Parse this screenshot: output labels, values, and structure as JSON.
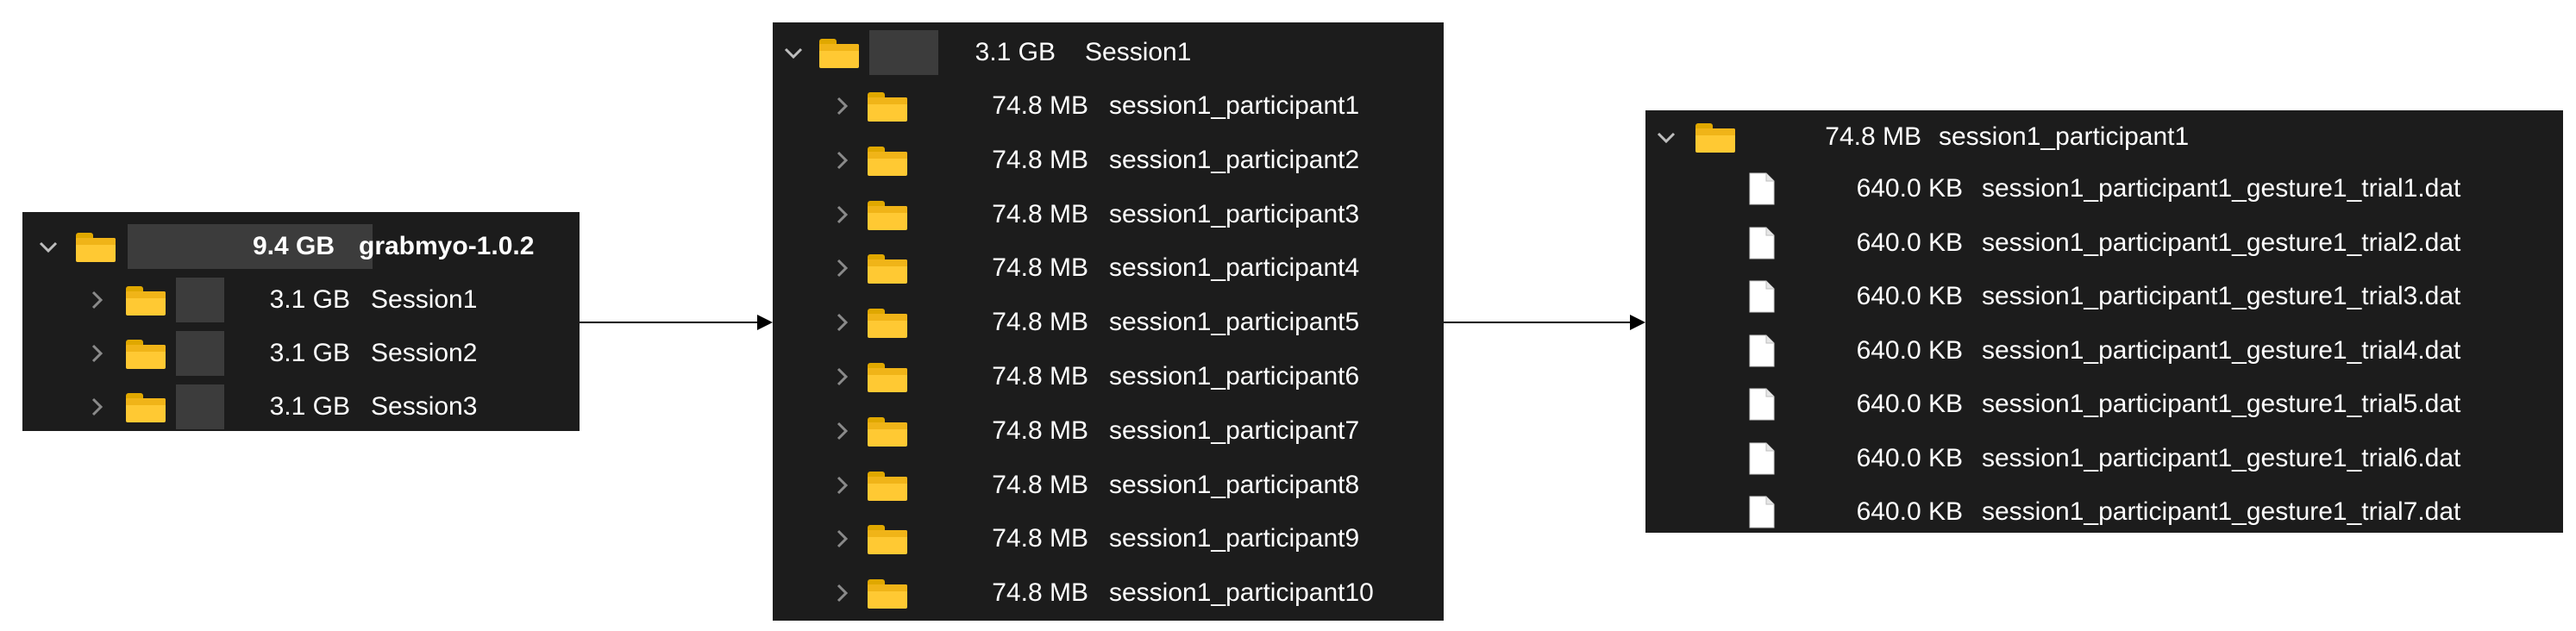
{
  "colors": {
    "panel_bg": "#1c1c1c",
    "text": "#ffffff",
    "folder": "#ffc933",
    "chevron": "#9a9a9a",
    "arrow": "#000000"
  },
  "icons": {
    "expanded": "chevron-down-icon",
    "collapsed": "chevron-right-icon",
    "folder": "folder-icon",
    "file": "file-icon"
  },
  "root": {
    "size": "9.4 GB",
    "name": "grabmyo-1.0.2",
    "children": [
      {
        "size": "3.1 GB",
        "name": "Session1"
      },
      {
        "size": "3.1 GB",
        "name": "Session2"
      },
      {
        "size": "3.1 GB",
        "name": "Session3"
      }
    ]
  },
  "session": {
    "size": "3.1 GB",
    "name": "Session1",
    "children": [
      {
        "size": "74.8 MB",
        "name": "session1_participant1"
      },
      {
        "size": "74.8 MB",
        "name": "session1_participant2"
      },
      {
        "size": "74.8 MB",
        "name": "session1_participant3"
      },
      {
        "size": "74.8 MB",
        "name": "session1_participant4"
      },
      {
        "size": "74.8 MB",
        "name": "session1_participant5"
      },
      {
        "size": "74.8 MB",
        "name": "session1_participant6"
      },
      {
        "size": "74.8 MB",
        "name": "session1_participant7"
      },
      {
        "size": "74.8 MB",
        "name": "session1_participant8"
      },
      {
        "size": "74.8 MB",
        "name": "session1_participant9"
      },
      {
        "size": "74.8 MB",
        "name": "session1_participant10"
      }
    ]
  },
  "participant": {
    "size": "74.8 MB",
    "name": "session1_participant1",
    "files": [
      {
        "size": "640.0 KB",
        "name": "session1_participant1_gesture1_trial1.dat"
      },
      {
        "size": "640.0 KB",
        "name": "session1_participant1_gesture1_trial2.dat"
      },
      {
        "size": "640.0 KB",
        "name": "session1_participant1_gesture1_trial3.dat"
      },
      {
        "size": "640.0 KB",
        "name": "session1_participant1_gesture1_trial4.dat"
      },
      {
        "size": "640.0 KB",
        "name": "session1_participant1_gesture1_trial5.dat"
      },
      {
        "size": "640.0 KB",
        "name": "session1_participant1_gesture1_trial6.dat"
      },
      {
        "size": "640.0 KB",
        "name": "session1_participant1_gesture1_trial7.dat"
      }
    ]
  }
}
